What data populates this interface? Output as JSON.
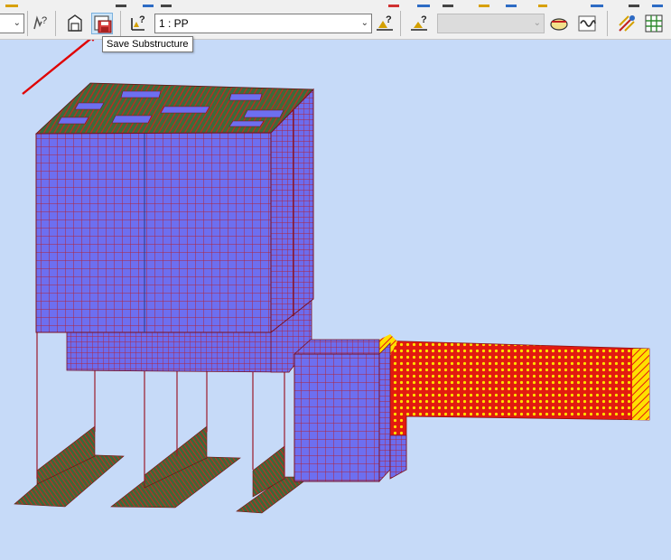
{
  "toolbar": {
    "load_case_combo": {
      "value": "1 : PP"
    },
    "second_combo": {
      "value": ""
    },
    "tooltip": "Save Substructure"
  },
  "icons": [
    "pointer-help-icon",
    "save-structure-icon",
    "save-substructure-icon",
    "load-help-icon",
    "load-display-icon",
    "load-edit-icon",
    "support-icon",
    "wave-icon",
    "mesh-check-icon",
    "grid-icon"
  ],
  "colors": {
    "background": "#c6daf8",
    "plate_blue": "#6d6ff0",
    "mesh_lines": "#c81e1e",
    "selected_red": "#e61e10",
    "selected_yellow": "#ffe000",
    "annotation_arrow": "#e00000"
  }
}
